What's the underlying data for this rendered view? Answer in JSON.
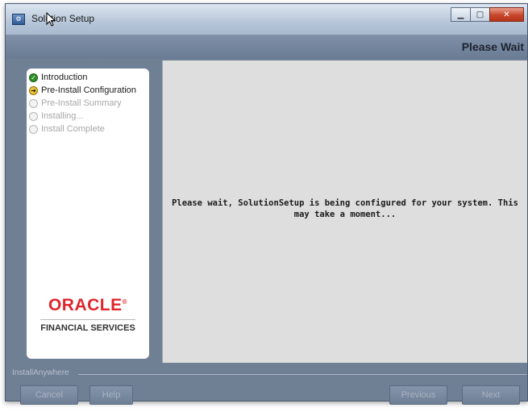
{
  "window": {
    "title": "Solution Setup",
    "app_icon": "installer-icon"
  },
  "header": {
    "step_title": "Please Wait"
  },
  "steps": [
    {
      "label": "Introduction",
      "status": "done"
    },
    {
      "label": "Pre-Install Configuration",
      "status": "current"
    },
    {
      "label": "Pre-Install Summary",
      "status": "pending"
    },
    {
      "label": "Installing...",
      "status": "pending"
    },
    {
      "label": "Install Complete",
      "status": "pending"
    }
  ],
  "logo": {
    "brand": "ORACLE",
    "division": "FINANCIAL SERVICES"
  },
  "main": {
    "message": "Please wait, SolutionSetup is being configured for your system.  This may take a moment..."
  },
  "footer": {
    "vendor": "InstallAnywhere",
    "cancel": "Cancel",
    "help": "Help",
    "previous": "Previous",
    "next": "Next"
  },
  "colors": {
    "panel": "#6f7f94",
    "content": "#dedede",
    "brand_red": "#e0262b",
    "done_green": "#2f8f26"
  }
}
